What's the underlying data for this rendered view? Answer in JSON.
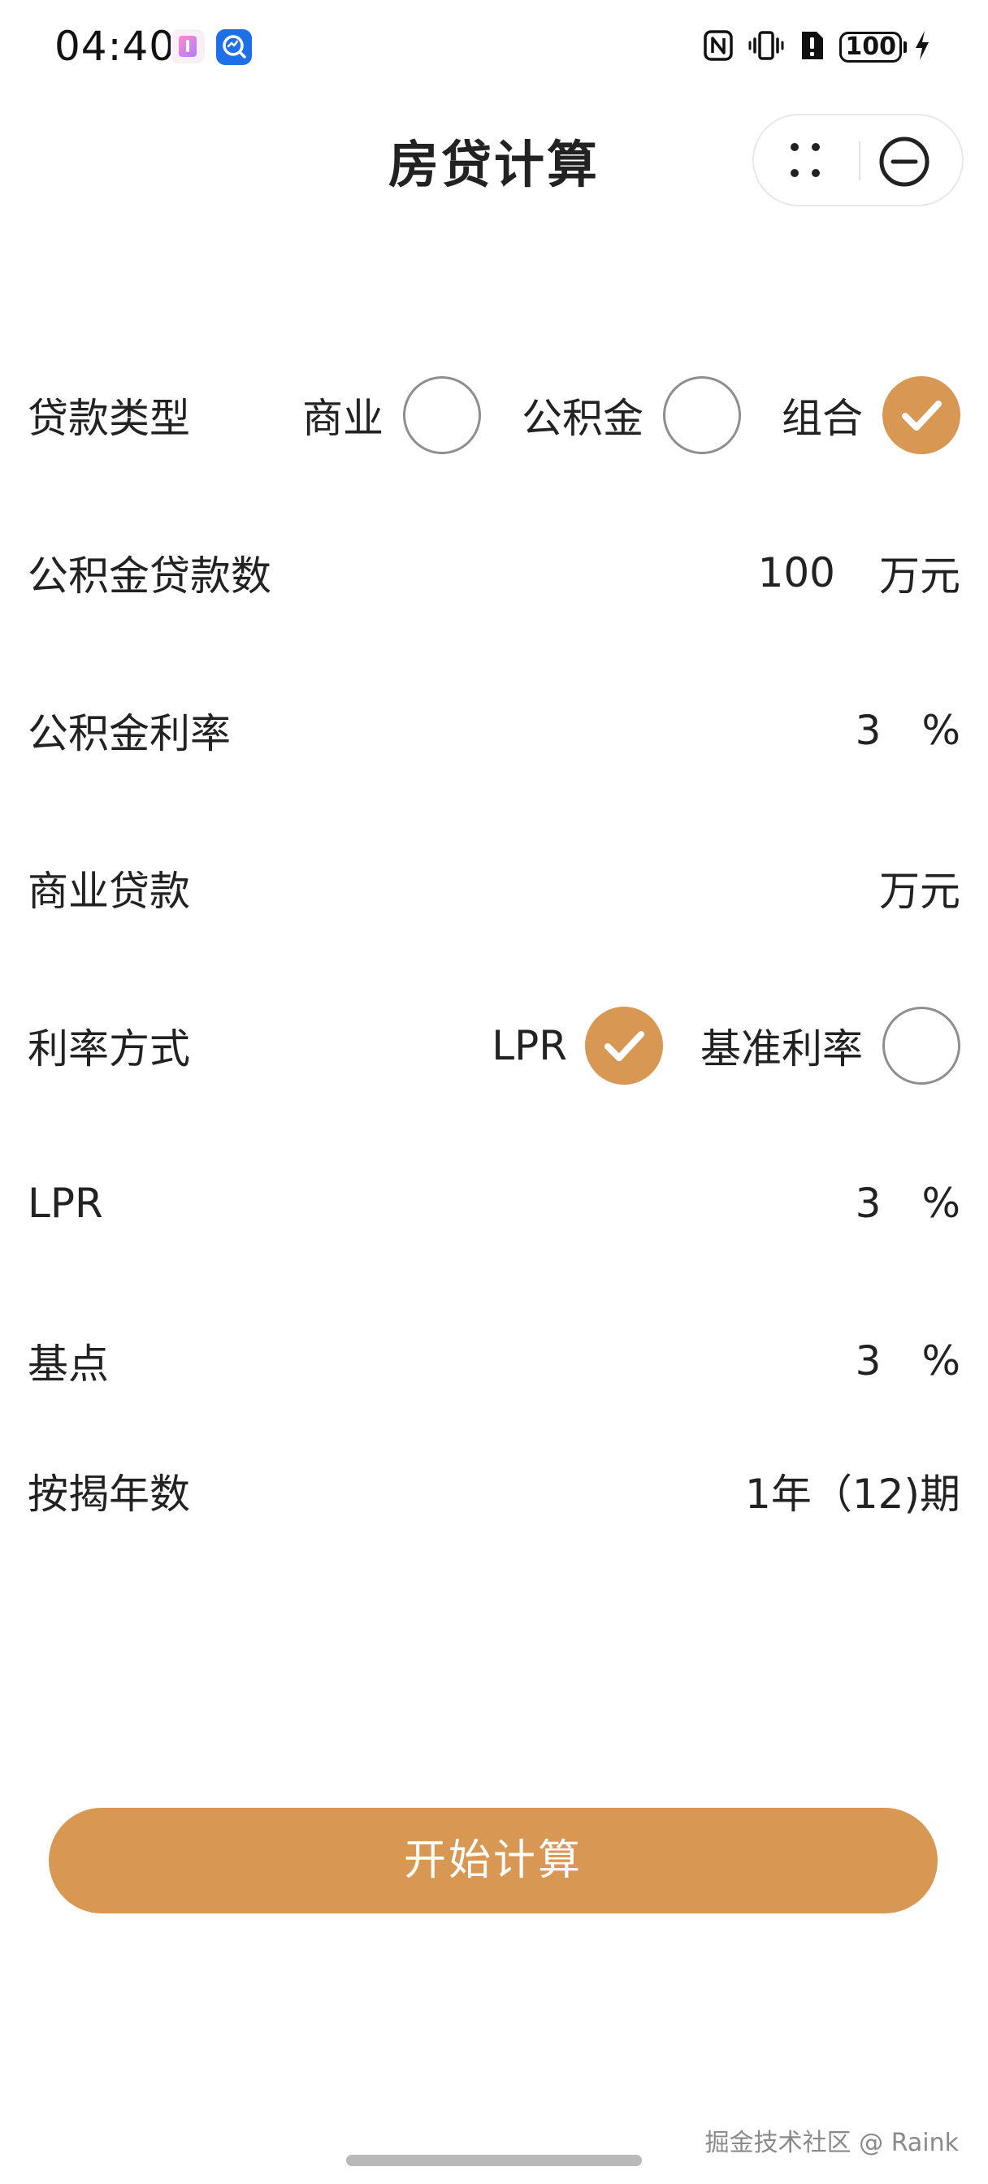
{
  "status_bar": {
    "time": "04:40",
    "battery": "100",
    "icons": [
      "app-notification-icon",
      "app-search-icon",
      "nfc-icon",
      "vibrate-icon",
      "alert-icon",
      "battery-icon",
      "charging-icon"
    ]
  },
  "header": {
    "title": "房贷计算",
    "capsule_icons": [
      "more-dots-icon",
      "close-circle-icon"
    ]
  },
  "form": {
    "loan_type": {
      "label": "贷款类型",
      "options": [
        {
          "label": "商业",
          "selected": false
        },
        {
          "label": "公积金",
          "selected": false
        },
        {
          "label": "组合",
          "selected": true
        }
      ]
    },
    "fund_amount": {
      "label": "公积金贷款数",
      "value": "100",
      "unit": "万元"
    },
    "fund_rate": {
      "label": "公积金利率",
      "value": "3",
      "unit": "%"
    },
    "commercial_amount": {
      "label": "商业贷款",
      "value": "",
      "unit": "万元"
    },
    "rate_mode": {
      "label": "利率方式",
      "options": [
        {
          "label": "LPR",
          "selected": true
        },
        {
          "label": "基准利率",
          "selected": false
        }
      ]
    },
    "lpr": {
      "label": "LPR",
      "value": "3",
      "unit": "%"
    },
    "basis_points": {
      "label": "基点",
      "value": "3",
      "unit": "%"
    },
    "mortgage_years": {
      "label": "按揭年数",
      "value": "1年（12)期"
    }
  },
  "actions": {
    "start_label": "开始计算"
  },
  "footer": {
    "watermark": "掘金技术社区 @ Raink"
  },
  "colors": {
    "accent": "#d89752",
    "text": "#222222",
    "radio_border": "#8e8e8e"
  }
}
